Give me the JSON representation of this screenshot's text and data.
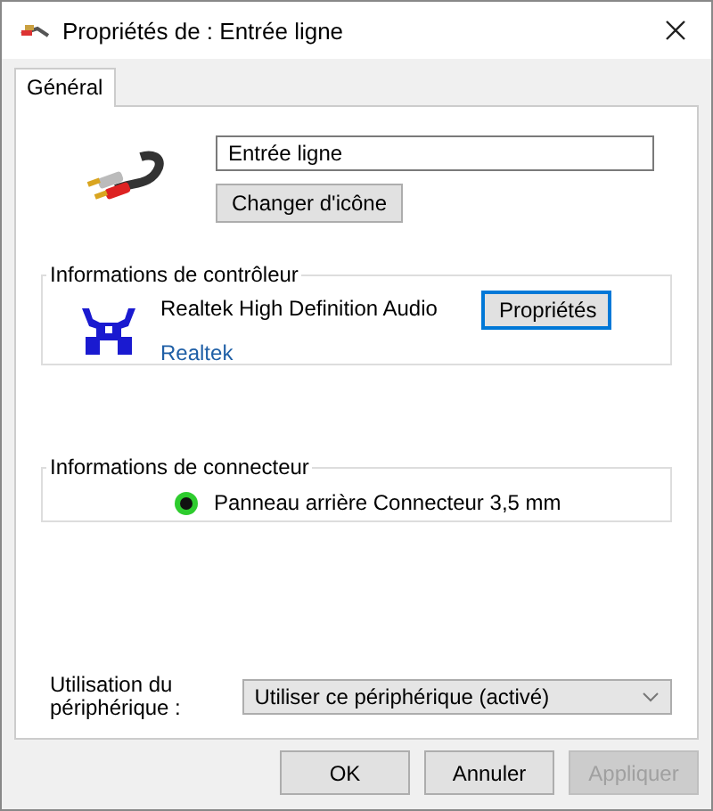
{
  "window": {
    "title": "Propriétés de : Entrée ligne"
  },
  "tabs": [
    {
      "label": "Général",
      "selected": true
    }
  ],
  "device": {
    "name": "Entrée ligne",
    "change_icon_button": "Changer d'icône"
  },
  "controller": {
    "legend": "Informations de contrôleur",
    "name": "Realtek High Definition Audio",
    "vendor": "Realtek",
    "properties_button": "Propriétés"
  },
  "connector": {
    "legend": "Informations de connecteur",
    "text": "Panneau arrière Connecteur 3,5 mm",
    "color": "#2ecc2e"
  },
  "usage": {
    "label": "Utilisation du périphérique :",
    "value": "Utiliser ce périphérique (activé)"
  },
  "buttons": [
    {
      "label": "OK",
      "disabled": false
    },
    {
      "label": "Annuler",
      "disabled": false
    },
    {
      "label": "Appliquer",
      "disabled": true
    }
  ]
}
